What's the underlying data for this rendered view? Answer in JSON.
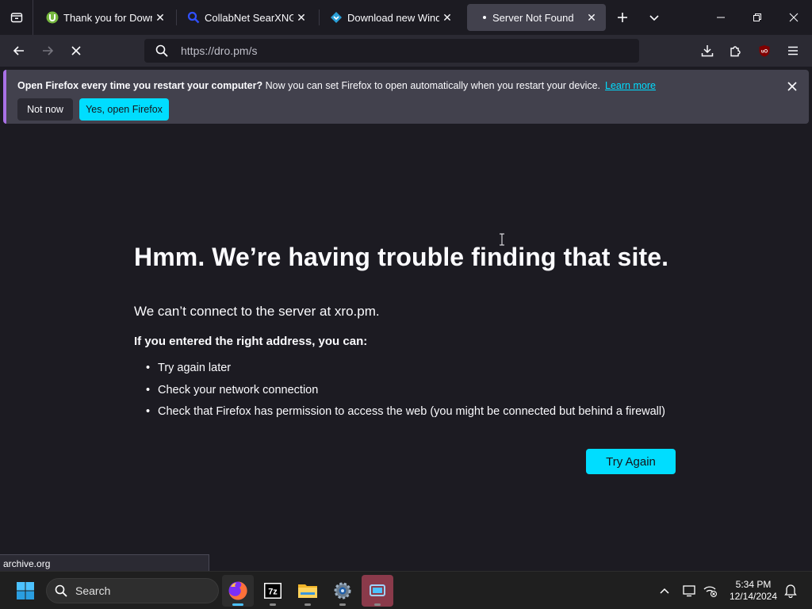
{
  "tabs": [
    {
      "title": "Thank you for Downlo",
      "favicon": "utorrent-icon",
      "active": false
    },
    {
      "title": "CollabNet SearXNG",
      "favicon": "searxng-icon",
      "active": false
    },
    {
      "title": "Download new Windo",
      "favicon": "download-site-icon",
      "active": false
    },
    {
      "title": "Server Not Found",
      "favicon": "loading-dot-icon",
      "active": true
    }
  ],
  "urlbar": {
    "value": "https://dro.pm/s"
  },
  "notification": {
    "bold_text": "Open Firefox every time you restart your computer?",
    "text": " Now you can set Firefox to open automatically when you restart your device.",
    "link": "Learn more",
    "btn_not_now": "Not now",
    "btn_yes": "Yes, open Firefox"
  },
  "error": {
    "title": "Hmm. We’re having trouble finding that site.",
    "description": "We can’t connect to the server at xro.pm.",
    "subtitle": "If you entered the right address, you can:",
    "items": [
      "Try again later",
      "Check your network connection",
      "Check that Firefox has permission to access the web (you might be connected but behind a firewall)"
    ],
    "button": "Try Again"
  },
  "status": {
    "text": "archive.org"
  },
  "taskbar": {
    "search_label": "Search",
    "time": "5:34 PM",
    "date": "12/14/2024"
  },
  "colors": {
    "accent": "#00ddff",
    "bg": "#1c1b22",
    "toolbar": "#2b2a33",
    "notification": "#42414d"
  }
}
